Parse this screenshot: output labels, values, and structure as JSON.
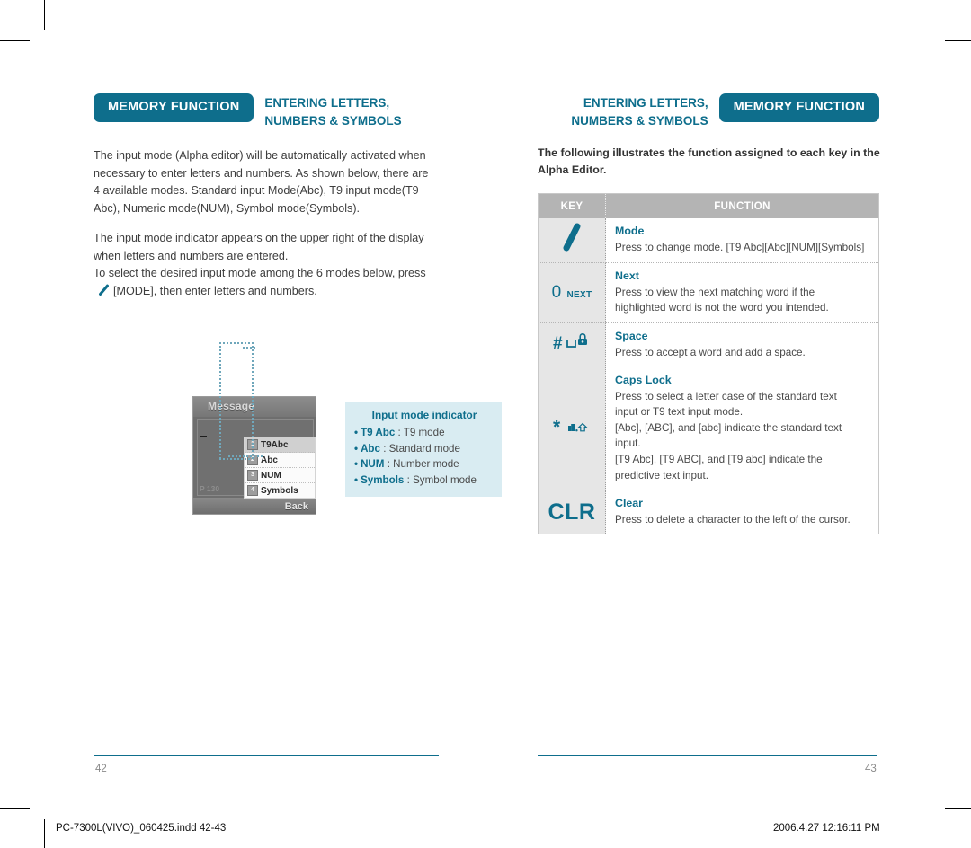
{
  "document": {
    "left_page": {
      "badge_label": "MEMORY FUNCTION",
      "chapter_title_line1": "ENTERING LETTERS,",
      "chapter_title_line2": "NUMBERS & SYMBOLS",
      "paragraph_1": "The input mode (Alpha editor) will be automatically activated when necessary to enter letters and numbers. As shown below, there are 4 available modes. Standard input Mode(Abc), T9 input mode(T9 Abc), Numeric mode(NUM), Symbol mode(Symbols).",
      "paragraph_2_part1": "The input mode indicator appears on the upper right  of the display when letters and numbers are entered.",
      "paragraph_2_part2": "To select the desired input mode among the 6 modes below, press",
      "paragraph_2_part3": "[MODE], then enter letters and numbers.",
      "page_number": "42"
    },
    "phone_screenshot": {
      "screen_title": "Message",
      "char_counter": "P 130",
      "softkey_right": "Back",
      "menu_items": [
        {
          "number": "1",
          "label": "T9Abc",
          "selected": true
        },
        {
          "number": "2",
          "label": "Abc",
          "selected": false
        },
        {
          "number": "3",
          "label": "NUM",
          "selected": false
        },
        {
          "number": "4",
          "label": "Symbols",
          "selected": false
        }
      ]
    },
    "callout": {
      "title": "Input mode indicator",
      "items": [
        {
          "term": "T9 Abc",
          "desc": ": T9 mode"
        },
        {
          "term": "Abc",
          "desc": ": Standard mode"
        },
        {
          "term": "NUM",
          "desc": ": Number mode"
        },
        {
          "term": "Symbols",
          "desc": ": Symbol mode"
        }
      ]
    },
    "right_page": {
      "badge_label": "MEMORY FUNCTION",
      "chapter_title_line1": "ENTERING LETTERS,",
      "chapter_title_line2": "NUMBERS & SYMBOLS",
      "intro": "The following illustrates the function assigned to each key in the Alpha Editor.",
      "page_number": "43"
    },
    "key_table": {
      "columns": [
        "KEY",
        "FUNCTION"
      ],
      "rows": [
        {
          "key_icon": "mode-stroke-icon",
          "key_label": "",
          "function_title": "Mode",
          "function_lines": [
            "Press to change mode. [T9 Abc][Abc][NUM][Symbols]"
          ]
        },
        {
          "key_icon": "zero-next-key-icon",
          "key_label": "0 NEXT",
          "function_title": "Next",
          "function_lines": [
            "Press to view the next matching word if the",
            "highlighted word is not the word you intended."
          ]
        },
        {
          "key_icon": "hash-space-lock-key-icon",
          "key_label": "#",
          "function_title": "Space",
          "function_lines": [
            "Press to accept a word and add a space."
          ]
        },
        {
          "key_icon": "asterisk-shift-key-icon",
          "key_label": "*",
          "function_title": "Caps Lock",
          "function_lines": [
            "Press to select a letter case of the standard text",
            "input or T9 text input mode.",
            "[Abc], [ABC], and [abc] indicate the standard text",
            "input.",
            "[T9 Abc], [T9 ABC], and [T9 abc] indicate the",
            "predictive text input."
          ]
        },
        {
          "key_icon": "clr-key-icon",
          "key_label": "CLR",
          "function_title": "Clear",
          "function_lines": [
            "Press to delete a character to the left of the cursor."
          ]
        }
      ]
    },
    "print_bar": {
      "file_info": "PC-7300L(VIVO)_060425.indd   42-43",
      "timestamp": "2006.4.27   12:16:11 PM"
    },
    "colors": {
      "brand_teal": "#0e6e8c",
      "callout_bg": "#d9ecf2",
      "table_header_gray": "#b4b4b4",
      "key_cell_gray": "#e6e6e6"
    }
  }
}
